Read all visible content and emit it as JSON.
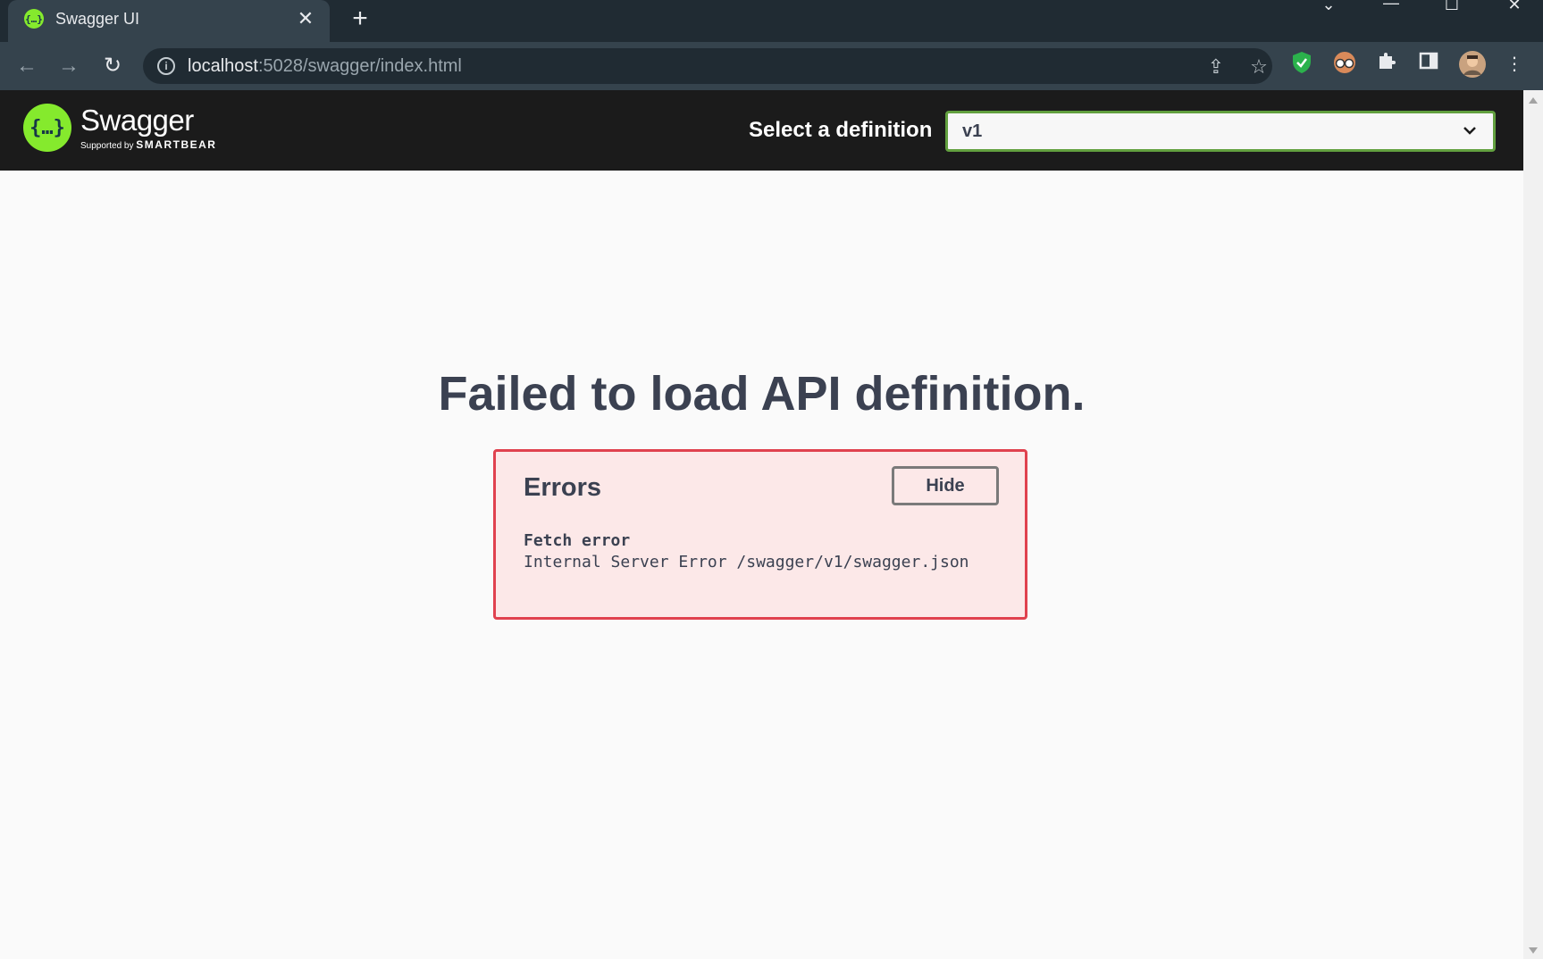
{
  "browser": {
    "tab_title": "Swagger UI",
    "tab_close": "✕",
    "new_tab": "+",
    "url_host": "localhost",
    "url_rest": ":5028/swagger/index.html"
  },
  "swagger": {
    "brand": "Swagger",
    "supported_by": "Supported by",
    "company": "SMARTBEAR",
    "select_label": "Select a definition",
    "selected_definition": "v1",
    "accent_color": "#85ea2d"
  },
  "main": {
    "heading": "Failed to load API definition.",
    "errors": {
      "title": "Errors",
      "hide_label": "Hide",
      "source": "Fetch error",
      "message": "Internal Server Error /swagger/v1/swagger.json"
    }
  },
  "colors": {
    "error_border": "#e0414e",
    "error_bg": "#fce8e8",
    "topbar_bg": "#1b1b1b",
    "select_border": "#62a03f"
  }
}
